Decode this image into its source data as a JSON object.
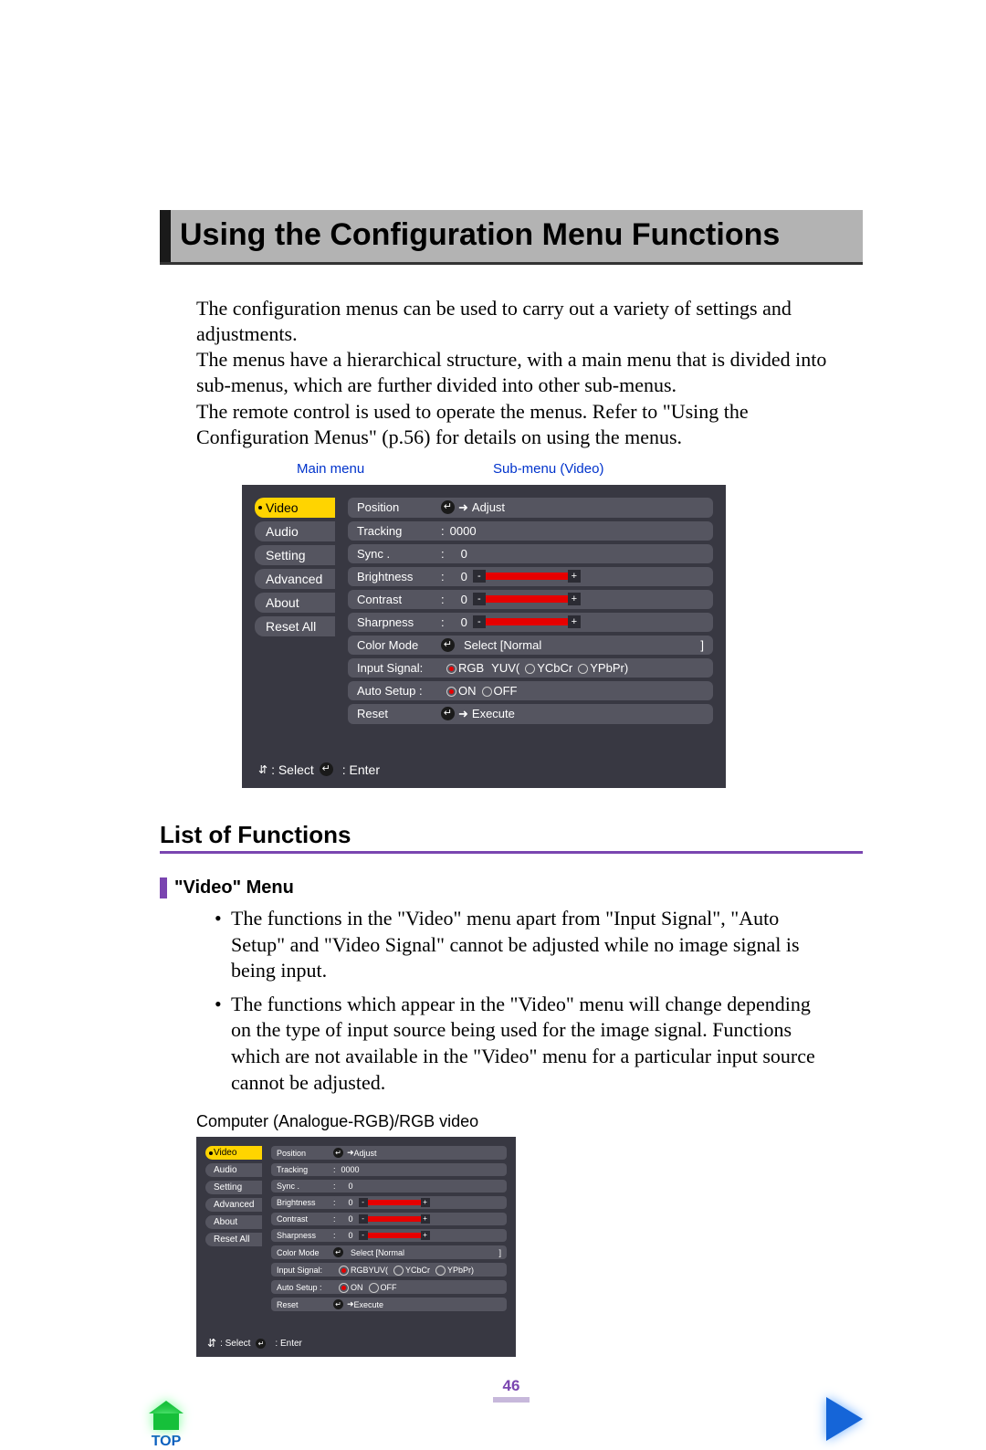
{
  "heading": "Using the Configuration Menu Functions",
  "para1": "The configuration menus can be used to carry out a variety of settings and adjustments.",
  "para2": "The menus have a hierarchical structure, with a main menu that is divided into sub-menus, which are further divided into other sub-menus.",
  "para3": "The remote control is used to operate the menus. Refer to \"Using the Configuration Menus\" (p.56) for details on using the menus.",
  "labels": {
    "main": "Main menu",
    "sub": "Sub-menu (Video)"
  },
  "main_menu": [
    "Video",
    "Audio",
    "Setting",
    "Advanced",
    "About",
    "Reset All"
  ],
  "submenu": {
    "position": {
      "label": "Position",
      "action": "Adjust"
    },
    "tracking": {
      "label": "Tracking",
      "value": "0000"
    },
    "sync": {
      "label": "Sync .",
      "value": "0"
    },
    "brightness": {
      "label": "Brightness",
      "value": "0"
    },
    "contrast": {
      "label": "Contrast",
      "value": "0"
    },
    "sharpness": {
      "label": "Sharpness",
      "value": "0"
    },
    "color_mode": {
      "label": "Color Mode",
      "hint": "Select  [Normal",
      "tail": "]"
    },
    "input_signal": {
      "label": "Input Signal:",
      "opts": [
        "RGB",
        "YUV(",
        "YCbCr",
        "YPbPr)"
      ]
    },
    "auto_setup": {
      "label": "Auto Setup :",
      "on": "ON",
      "off": "OFF"
    },
    "reset": {
      "label": "Reset",
      "action": "Execute"
    }
  },
  "footer": {
    "select": ": Select",
    "enter": ": Enter"
  },
  "h2": "List of Functions",
  "h3": "\"Video\" Menu",
  "bullets": [
    "The functions in the \"Video\" menu apart from \"Input Signal\", \"Auto Setup\" and \"Video Signal\" cannot be adjusted while no image signal is being input.",
    "The functions which appear in the \"Video\" menu will change depending on the type of input source being used for the image signal. Functions which are not available in the \"Video\" menu for a particular input source cannot be adjusted."
  ],
  "fig_caption": "Computer (Analogue-RGB)/RGB video",
  "page_no": "46",
  "top_label": "TOP",
  "icons": {
    "enter": "↵",
    "arrow": "➜",
    "updown": "⇵"
  }
}
